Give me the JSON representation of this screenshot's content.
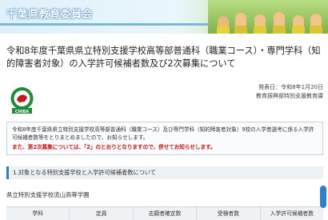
{
  "header": {
    "org_name": "千葉県教育委員会"
  },
  "page": {
    "title": "令和8年度千葉県県立特別支援学校高等部普通科（職業コース）・専門学科（知的障害者対象）の入学許可候補者数及び2次募集について",
    "published": "発表日：令和8年1月20日",
    "department": "教育振興部特別支援教育課",
    "emblem_label": "CHIBA"
  },
  "notice": {
    "body": "令和8年度千葉県県立特別支援学校高等部普通科（職業コース）及び専門学科（知的障害者対象）9校の入学者選考に係る入学許可候補者数等をとりまとめましたので、お知らせします。",
    "highlight": "また、第2次募集については、「2」のとおりとなりますので、併せてお知らせします。"
  },
  "section": {
    "heading": "1.対象となる特別支援学校と入学許可候補者数について",
    "school": "県立特別支援学校流山高等学園"
  },
  "table": {
    "headers": [
      "学科",
      "定員",
      "志願者確定数",
      "受検者数",
      "入学許可候補者数"
    ]
  },
  "colors": {
    "accent": "#2f7cc0",
    "alert": "#d0121b"
  }
}
